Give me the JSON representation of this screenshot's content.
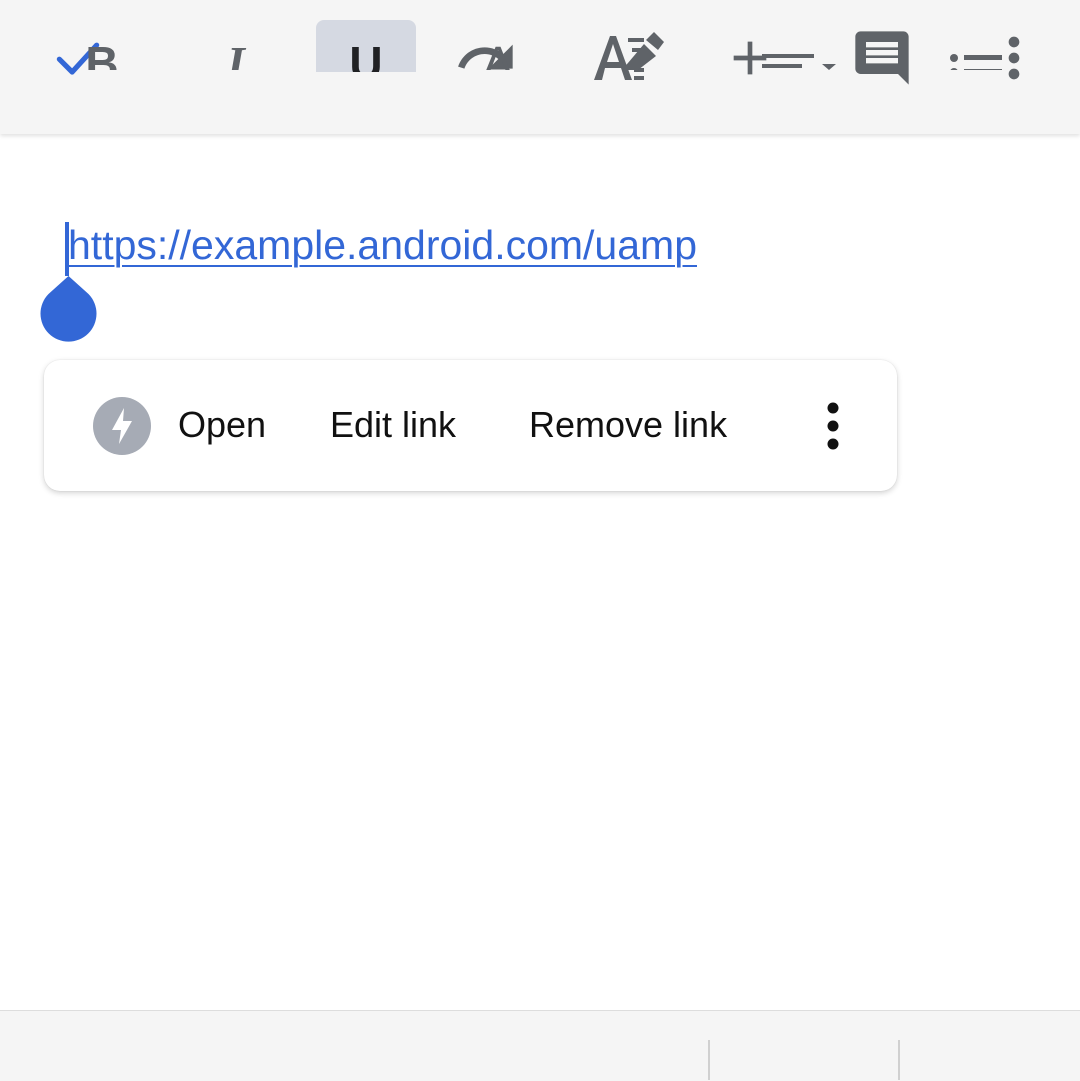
{
  "toolbar": {
    "icons": [
      "checkmark-icon",
      "undo-icon",
      "redo-icon",
      "text-format-icon",
      "add-icon",
      "comment-icon",
      "more-vert-icon"
    ],
    "accent_color": "#3367d6",
    "icon_color": "#5f6368"
  },
  "document": {
    "link_text": "https://example.android.com/uamp"
  },
  "link_popup": {
    "icon": "bolt-icon",
    "open_label": "Open",
    "edit_label": "Edit link",
    "remove_label": "Remove link",
    "more_icon": "more-vert-icon"
  },
  "format_bar": {
    "bold_label": "B",
    "italic_label": "I",
    "underline_label": "U",
    "text_color_label": "A",
    "icons": [
      "bold-icon",
      "italic-icon",
      "underline-icon",
      "text-color-icon",
      "highlight-icon",
      "align-icon",
      "bulleted-list-icon"
    ],
    "active_item": "underline"
  }
}
